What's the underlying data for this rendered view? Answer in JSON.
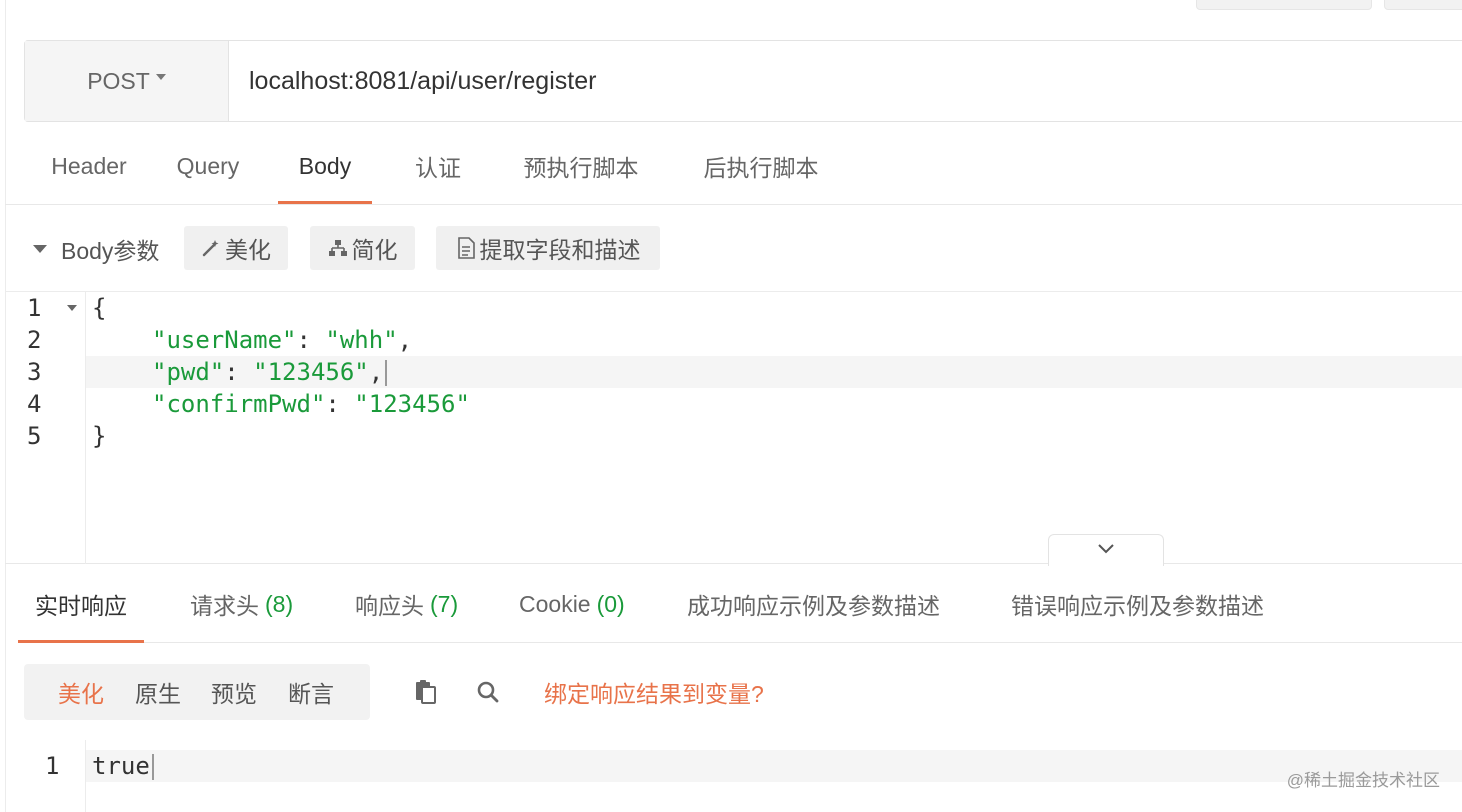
{
  "request": {
    "method": "POST",
    "url": "localhost:8081/api/user/register"
  },
  "request_tabs": [
    {
      "label": "Header",
      "active": false
    },
    {
      "label": "Query",
      "active": false
    },
    {
      "label": "Body",
      "active": true
    },
    {
      "label": "认证",
      "active": false
    },
    {
      "label": "预执行脚本",
      "active": false
    },
    {
      "label": "后执行脚本",
      "active": false
    }
  ],
  "body_params": {
    "title": "Body参数",
    "beautify_label": "美化",
    "simplify_label": "简化",
    "extract_label": "提取字段和描述"
  },
  "request_body": {
    "line_numbers": [
      "1",
      "2",
      "3",
      "4",
      "5"
    ],
    "open_brace": "{",
    "close_brace": "}",
    "fields": [
      {
        "key": "\"userName\"",
        "value": "\"whh\"",
        "sep": ","
      },
      {
        "key": "\"pwd\"",
        "value": "\"123456\"",
        "sep": ","
      },
      {
        "key": "\"confirmPwd\"",
        "value": "\"123456\"",
        "sep": ""
      }
    ],
    "highlighted_line": 3
  },
  "response_tabs": [
    {
      "label": "实时响应",
      "count": "",
      "active": true
    },
    {
      "label": "请求头",
      "count": "(8)",
      "active": false
    },
    {
      "label": "响应头",
      "count": "(7)",
      "active": false
    },
    {
      "label": "Cookie",
      "count": "(0)",
      "active": false
    },
    {
      "label": "成功响应示例及参数描述",
      "count": "",
      "active": false
    },
    {
      "label": "错误响应示例及参数描述",
      "count": "",
      "active": false
    }
  ],
  "response_toolbar": {
    "view_modes": [
      "美化",
      "原生",
      "预览",
      "断言"
    ],
    "active_mode": "美化",
    "icons": [
      "copy-icon",
      "search-icon"
    ],
    "bind_link": "绑定响应结果到变量?"
  },
  "response_body": {
    "line_number": "1",
    "text": "true"
  },
  "watermark": "@稀土掘金技术社区",
  "colors": {
    "accent": "#e8734a",
    "string": "#1a9a3a",
    "count": "#1a9a3a"
  }
}
